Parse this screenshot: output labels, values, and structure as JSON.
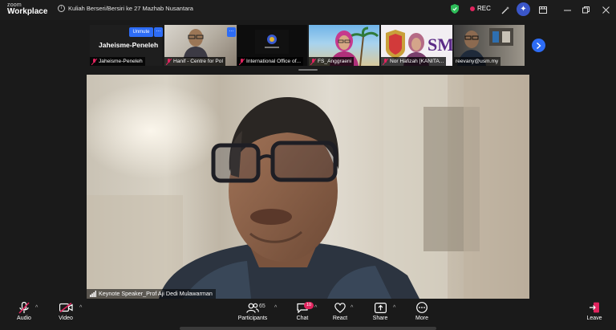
{
  "app": {
    "brand_top": "zoom",
    "brand_main": "Workplace",
    "meeting_title": "Kuliah Berseri/Bersiri ke 27 Mazhab Nusantara",
    "rec_label": "REC"
  },
  "gallery": {
    "self_name": "Jaheisme-Peneleh",
    "unmute_label": "Unmute",
    "more_label": "…",
    "tiles": [
      {
        "label": "Jaheisme-Peneleh"
      },
      {
        "label": "Hanif - Centre for Pol"
      },
      {
        "label": "International Office of..."
      },
      {
        "label": "FS_Anggraeni"
      },
      {
        "label": "Nor Hafizah [KANITA..."
      },
      {
        "label": "reevany@usm.my"
      }
    ]
  },
  "main": {
    "speaker_label": "Keynote Speaker_Prof Aji Dedi Mulawarman"
  },
  "toolbar": {
    "audio_label": "Audio",
    "video_label": "Video",
    "participants_label": "Participants",
    "participants_count": "65",
    "chat_label": "Chat",
    "chat_badge": "10",
    "react_label": "React",
    "share_label": "Share",
    "more_label": "More",
    "leave_label": "Leave"
  },
  "colors": {
    "accent": "#2d6cf5",
    "record": "#e0245e",
    "mute": "#e0245e",
    "background": "#1a1a1a"
  }
}
